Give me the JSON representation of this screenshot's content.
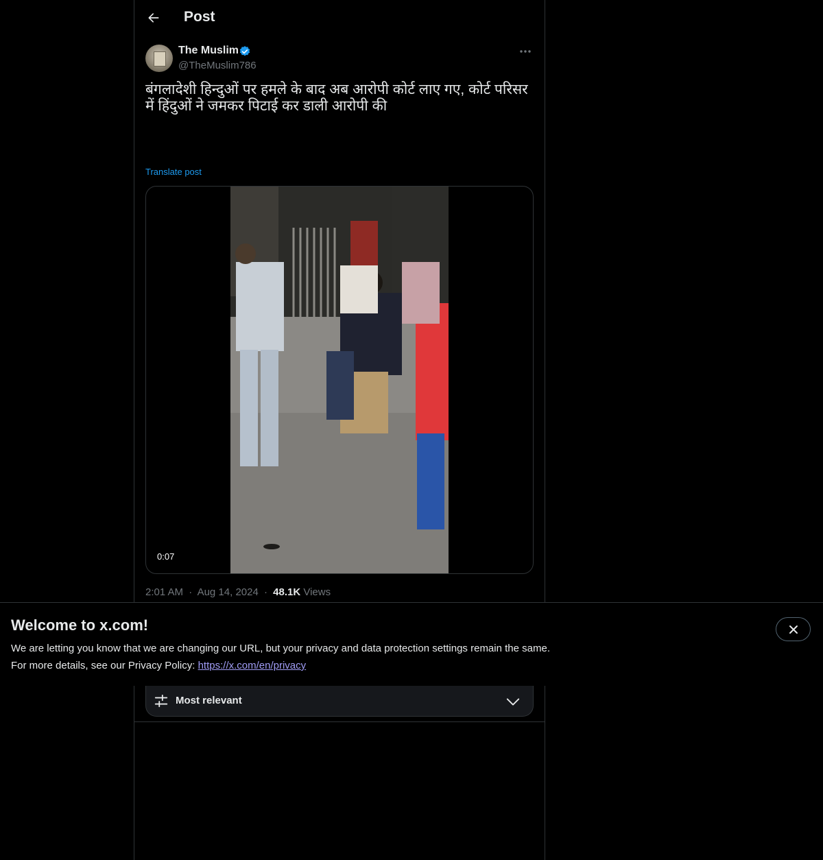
{
  "header": {
    "title": "Post",
    "back_icon": "arrow-left-icon"
  },
  "post": {
    "author_name": "The Muslim",
    "author_handle": "@TheMuslim786",
    "verified": true,
    "text": "बंगलादेशी हिन्दुओं पर हमले के बाद अब आरोपी कोर्ट लाए गए, कोर्ट परिसर में हिंदुओं ने जमकर पिटाई कर डाली आरोपी की",
    "translate_label": "Translate post",
    "video_duration": "0:07",
    "time": "2:01 AM",
    "separator": "·",
    "date": "Aug 14, 2024",
    "views_count": "48.1K",
    "views_label": "Views"
  },
  "banner": {
    "title": "Welcome to x.com!",
    "line1": "We are letting you know that we are changing our URL, but your privacy and data protection settings remain the same.",
    "line2_prefix": "For more details, see our Privacy Policy: ",
    "link": "https://x.com/en/privacy",
    "close_icon": "close-icon"
  },
  "replies": {
    "sort_label": "Most relevant",
    "sort_icon": "sliders-icon",
    "chevron_icon": "chevron-down-icon"
  },
  "colors": {
    "background": "#000000",
    "text": "#e7e9ea",
    "muted": "#71767b",
    "accent": "#1d9bf0",
    "link": "#a09cf5",
    "border": "#2f3336"
  }
}
